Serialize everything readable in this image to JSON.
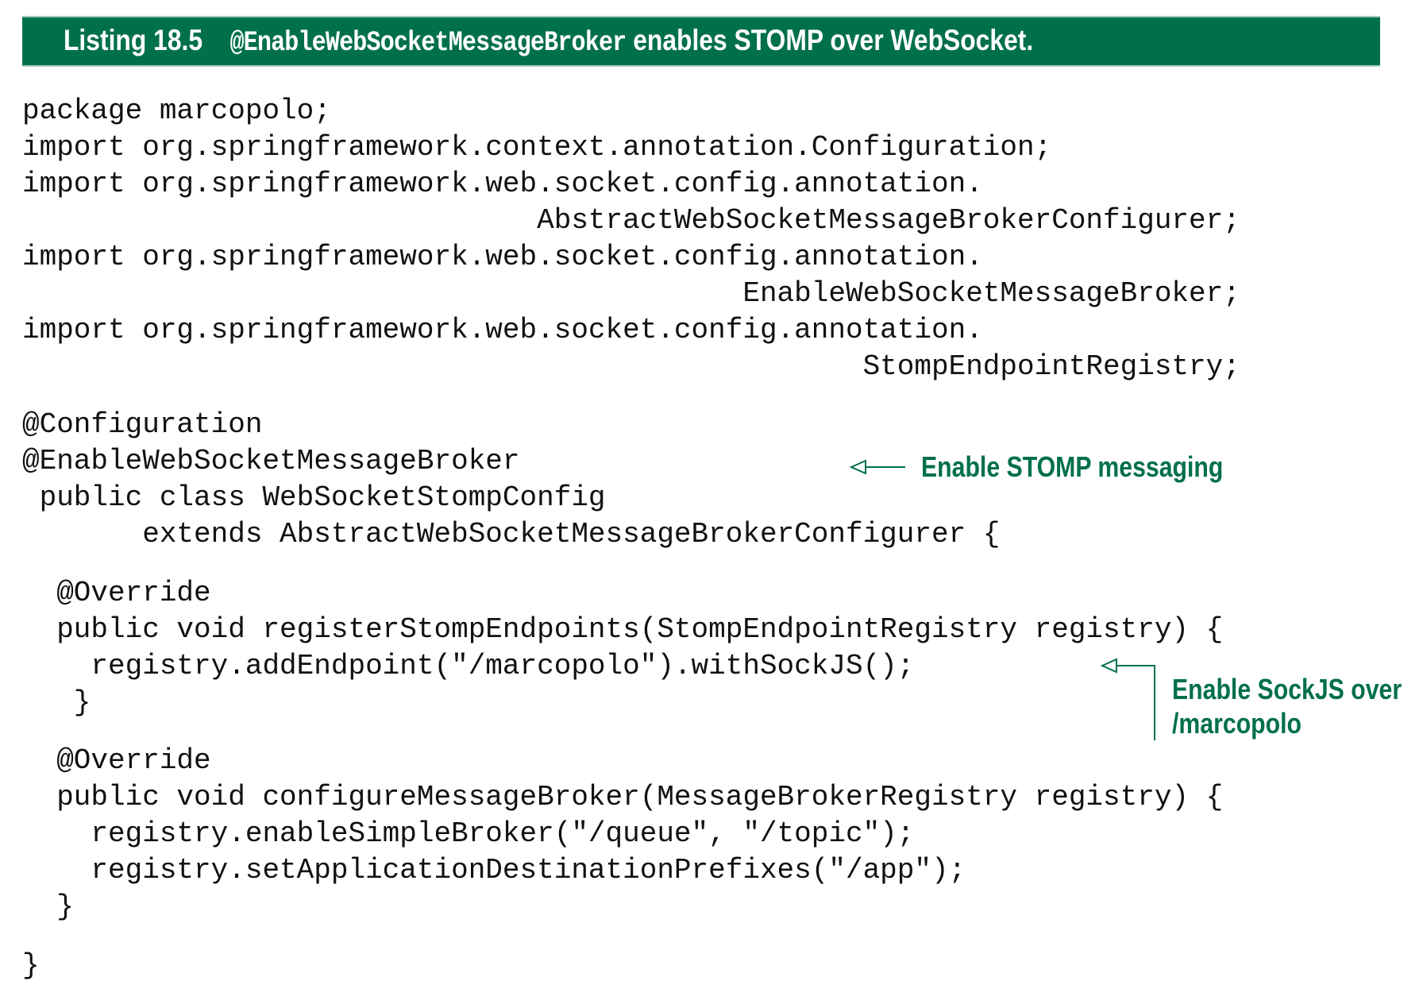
{
  "listing": {
    "number": "Listing 18.5",
    "title_code": "@EnableWebSocketMessageBroker",
    "title_text": " enables STOMP over WebSocket."
  },
  "code_lines": [
    "package marcopolo;",
    "import org.springframework.context.annotation.Configuration;",
    "import org.springframework.web.socket.config.annotation.",
    "                              AbstractWebSocketMessageBrokerConfigurer;",
    "import org.springframework.web.socket.config.annotation.",
    "                                          EnableWebSocketMessageBroker;",
    "import org.springframework.web.socket.config.annotation.",
    "                                                 StompEndpointRegistry;",
    "@Configuration",
    "@EnableWebSocketMessageBroker",
    " public class WebSocketStompConfig",
    "       extends AbstractWebSocketMessageBrokerConfigurer {",
    "  @Override",
    "  public void registerStompEndpoints(StompEndpointRegistry registry) {",
    "    registry.addEndpoint(\"/marcopolo\").withSockJS();",
    "   }",
    "  @Override",
    "  public void configureMessageBroker(MessageBrokerRegistry registry) {",
    "    registry.enableSimpleBroker(\"/queue\", \"/topic\");",
    "    registry.setApplicationDestinationPrefixes(\"/app\");",
    "  }",
    "}"
  ],
  "annotations": {
    "stomp": "Enable STOMP messaging",
    "sockjs_line1": "Enable SockJS over",
    "sockjs_line2": "/marcopolo"
  },
  "colors": {
    "accent": "#00704a"
  }
}
